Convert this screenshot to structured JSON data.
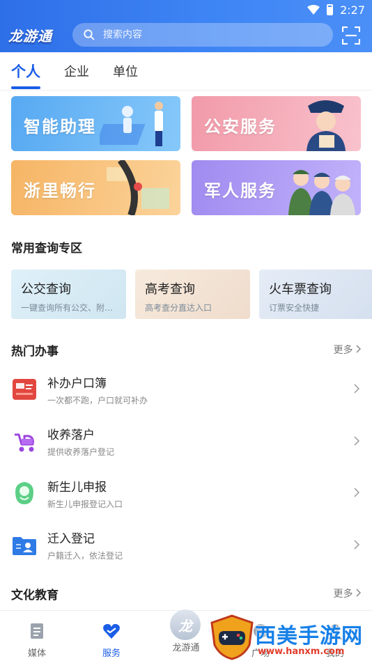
{
  "status_bar": {
    "time": "2:27"
  },
  "header": {
    "logo_text": "龙游通",
    "search_placeholder": "搜索内容"
  },
  "tabs": [
    {
      "label": "个人",
      "active": true
    },
    {
      "label": "企业",
      "active": false
    },
    {
      "label": "单位",
      "active": false
    }
  ],
  "banners": [
    {
      "title": "智能助理",
      "color": "#57a9f2"
    },
    {
      "title": "公安服务",
      "color": "#f29aa9"
    },
    {
      "title": "浙里畅行",
      "color": "#f6b565"
    },
    {
      "title": "军人服务",
      "color": "#a08bf0"
    }
  ],
  "common_query": {
    "title": "常用查询专区",
    "cards": [
      {
        "title": "公交查询",
        "subtitle": "一键查询所有公交、附…"
      },
      {
        "title": "高考查询",
        "subtitle": "高考查分直达入口"
      },
      {
        "title": "火车票查询",
        "subtitle": "订票安全快捷"
      }
    ]
  },
  "hot_affairs": {
    "title": "热门办事",
    "more": "更多",
    "items": [
      {
        "title": "补办户口簿",
        "subtitle": "一次都不跑，户口就可补办",
        "icon": "household-book-icon"
      },
      {
        "title": "收养落户",
        "subtitle": "提供收养落户登记",
        "icon": "stroller-icon"
      },
      {
        "title": "新生儿申报",
        "subtitle": "新生儿申报登记入口",
        "icon": "baby-icon"
      },
      {
        "title": "迁入登记",
        "subtitle": "户籍迁入，依法登记",
        "icon": "id-card-icon"
      }
    ]
  },
  "culture": {
    "title": "文化教育",
    "more": "更多"
  },
  "bottom_nav": [
    {
      "label": "媒体",
      "active": false
    },
    {
      "label": "服务",
      "active": true
    },
    {
      "label": "龙游通",
      "active": false
    },
    {
      "label": "广场",
      "active": false
    },
    {
      "label": "我的",
      "active": false
    }
  ],
  "watermark": {
    "text": "西美手游网",
    "url": "www.hanxm.com"
  },
  "colors": {
    "primary": "#1a5de6",
    "header_bg": "#3f86f5"
  }
}
